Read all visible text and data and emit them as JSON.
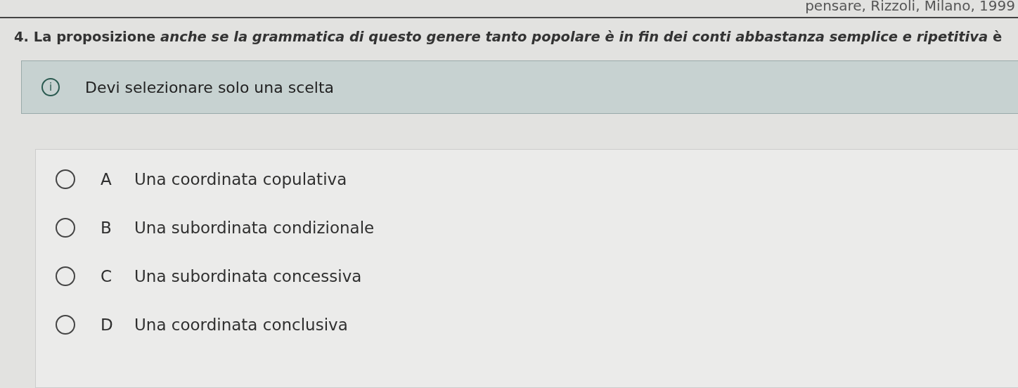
{
  "citation": "pensare, Rizzoli, Milano, 1999",
  "question": "4. La proposizione *anche se la grammatica di questo genere tanto popolare è in fin dei conti abbastanza semplice e ripetitiva* è",
  "notice": {
    "icon": "i",
    "text": "Devi selezionare solo una scelta"
  },
  "options": [
    {
      "letter": "A",
      "text": "Una coordinata copulativa",
      "selected": false
    },
    {
      "letter": "B",
      "text": "Una subordinata condizionale",
      "selected": false
    },
    {
      "letter": "C",
      "text": "Una subordinata concessiva",
      "selected": false
    },
    {
      "letter": "D",
      "text": "Una coordinata conclusiva",
      "selected": false
    }
  ]
}
